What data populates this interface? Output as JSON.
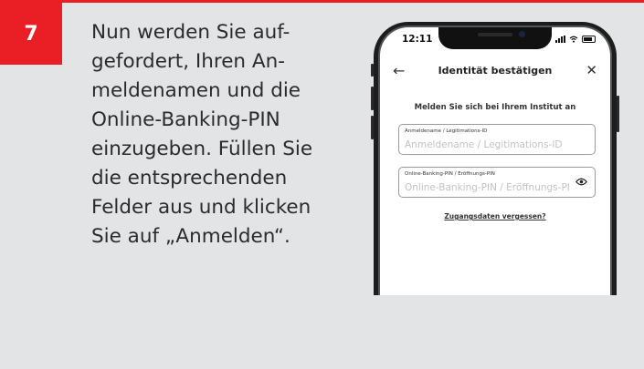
{
  "step": {
    "number": "7"
  },
  "instruction": {
    "lines": [
      "Nun werden Sie auf-",
      "gefordert, Ihren An-",
      "meldenamen und die",
      "Online-Banking-PIN",
      "einzugeben. Füllen Sie",
      "die entsprechenden",
      "Felder aus und klicken",
      "Sie auf „Anmelden“."
    ]
  },
  "phone": {
    "status_time": "12:11",
    "nav": {
      "back_icon": "back-arrow-icon",
      "title": "Identität bestätigen",
      "close_icon": "close-icon"
    },
    "prompt": "Melden Sie sich bei Ihrem Institut an",
    "fields": [
      {
        "label": "Anmeldename / Legitimations-ID",
        "value": "",
        "placeholder": "Anmeldename / Legitimations-ID"
      },
      {
        "label": "Online-Banking-PIN / Eröffnungs-PIN",
        "value": "",
        "placeholder": "Online-Banking-PIN / Eröffnungs-PIN",
        "icon": "eye-icon"
      }
    ],
    "forgot_link": "Zugangsdaten vergessen?"
  },
  "colors": {
    "accent": "#ea1f25",
    "background": "#e3e4e5"
  }
}
